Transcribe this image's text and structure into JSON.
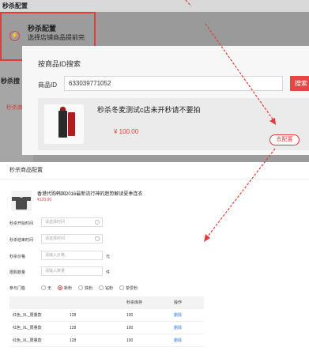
{
  "window": {
    "title": "秒杀配置"
  },
  "sidebar": {
    "label_1": "秒杀搜",
    "label_2": "秒杀商"
  },
  "menu_card": {
    "title": "秒杀配置",
    "desc": "选择店铺商品提前完"
  },
  "search": {
    "heading": "按商品ID搜索",
    "id_label": "商品ID",
    "id_value": "633039771052",
    "button_label": "搜索"
  },
  "product": {
    "title": "秒杀冬麦测试c店未开秒请不要拍",
    "price": "¥ 100.00",
    "config_button": "去配置"
  },
  "config": {
    "heading": "秒杀商品配置",
    "item_title": "香港代购韩国2016最新流行神的趋势解读夏季连衣",
    "item_price": "¥120.00",
    "start_label": "秒杀开始时间",
    "start_placeholder": "请选择时间",
    "end_label": "秒杀结束时间",
    "end_placeholder": "请选择时间",
    "price_label": "秒杀价格",
    "price_placeholder": "请输入价格",
    "price_unit": "元",
    "qty_label": "限购数量",
    "qty_placeholder": "请输入数量",
    "qty_unit": "件",
    "threshold_label": "参与门槛",
    "options": [
      "无",
      "新粉",
      "铁粉",
      "钻粉",
      "挚爱粉"
    ],
    "selected_option": "新粉",
    "table": {
      "headers": [
        "",
        "",
        "秒杀库存",
        "操作"
      ],
      "rows": [
        [
          "红色_XL_限量款",
          "128",
          "100",
          "删除"
        ],
        [
          "红色_XL_限量款",
          "128",
          "100",
          "删除"
        ],
        [
          "红色_XL_限量款",
          "128",
          "100",
          "删除"
        ]
      ]
    }
  },
  "colors": {
    "accent": "#e23b3b",
    "link": "#2d7be0"
  }
}
